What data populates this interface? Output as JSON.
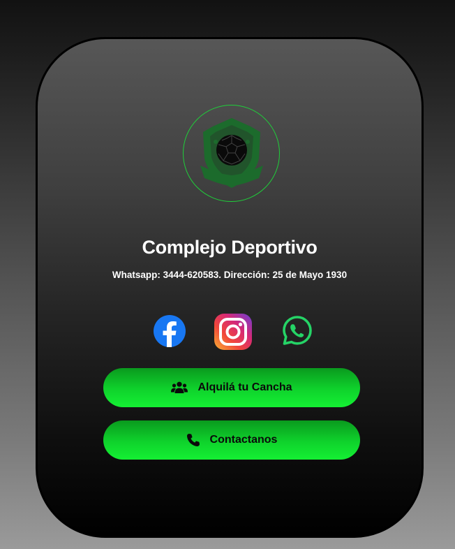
{
  "profile": {
    "title": "Complejo Deportivo",
    "subtitle": "Whatsapp: 3444-620583. Dirección: 25 de Mayo 1930"
  },
  "logo": {
    "icon": "soccer-shield-icon",
    "ring_color": "#1fcf3a",
    "shield_color": "#1c6b2c"
  },
  "socials": [
    {
      "name": "facebook",
      "icon": "facebook-icon",
      "color": "#1877f2"
    },
    {
      "name": "instagram",
      "icon": "instagram-icon",
      "color": "#e1306c"
    },
    {
      "name": "whatsapp",
      "icon": "whatsapp-icon",
      "color": "#25d366"
    }
  ],
  "buttons": {
    "rent_label": "Alquilá tu Cancha",
    "rent_icon": "users-icon",
    "contact_label": "Contactanos",
    "contact_icon": "phone-icon"
  },
  "colors": {
    "accent": "#14f033",
    "text": "#ffffff"
  }
}
